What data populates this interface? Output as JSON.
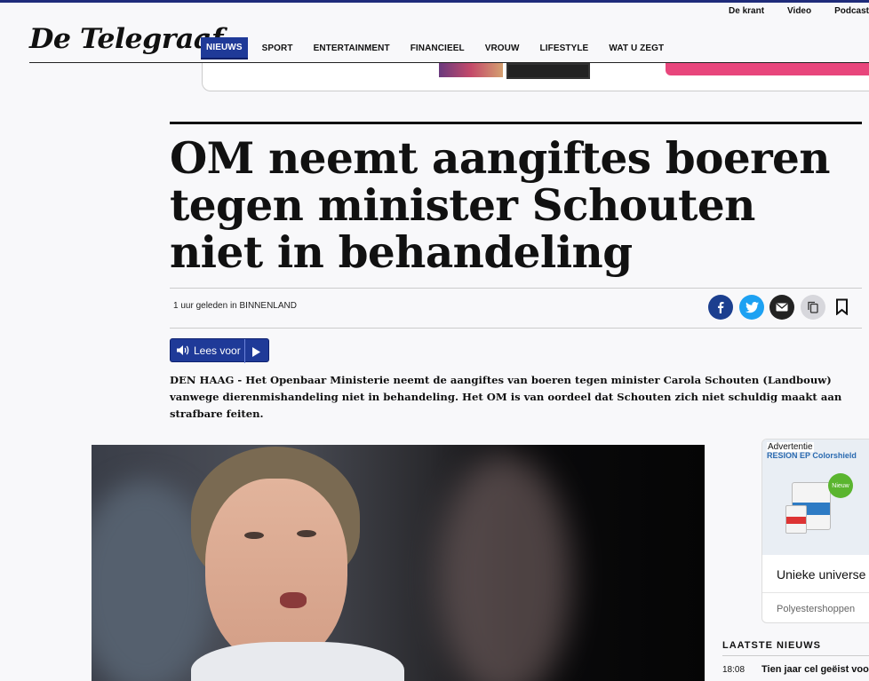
{
  "utility_nav": [
    "De krant",
    "Video",
    "Podcast"
  ],
  "logo": "De Telegraaf",
  "main_nav": [
    "NIEUWS",
    "SPORT",
    "ENTERTAINMENT",
    "FINANCIEEL",
    "VROUW",
    "LIFESTYLE",
    "WAT U ZEGT"
  ],
  "active_nav": "NIEUWS",
  "article": {
    "headline": "OM neemt aangiftes boeren tegen minister Schouten niet in behandeling",
    "meta": "1 uur geleden in BINNENLAND",
    "read_aloud": "Lees voor",
    "lead": "DEN HAAG - Het Openbaar Ministerie neemt de aangiftes van boeren tegen minister Carola Schouten (Landbouw) vanwege dierenmishandeling niet in behandeling. Het OM is van oordeel dat Schouten zich niet schuldig maakt aan strafbare feiten."
  },
  "share_icons": [
    "facebook-icon",
    "twitter-icon",
    "mail-icon",
    "copy-icon",
    "bookmark-icon"
  ],
  "ad": {
    "label": "Advertentie",
    "brand": "RESION EP Colorshield",
    "badge": "Nieuw",
    "title": "Unieke universe",
    "source": "Polyestershoppen"
  },
  "latest": {
    "heading": "LAATSTE NIEUWS",
    "items": [
      {
        "time": "18:08",
        "title": "Tien jaar cel geëist voo"
      }
    ]
  },
  "colors": {
    "brand_blue": "#1f3a98",
    "facebook": "#1c3f8f",
    "twitter": "#1da1f2",
    "promo_pink": "#e8467c"
  }
}
